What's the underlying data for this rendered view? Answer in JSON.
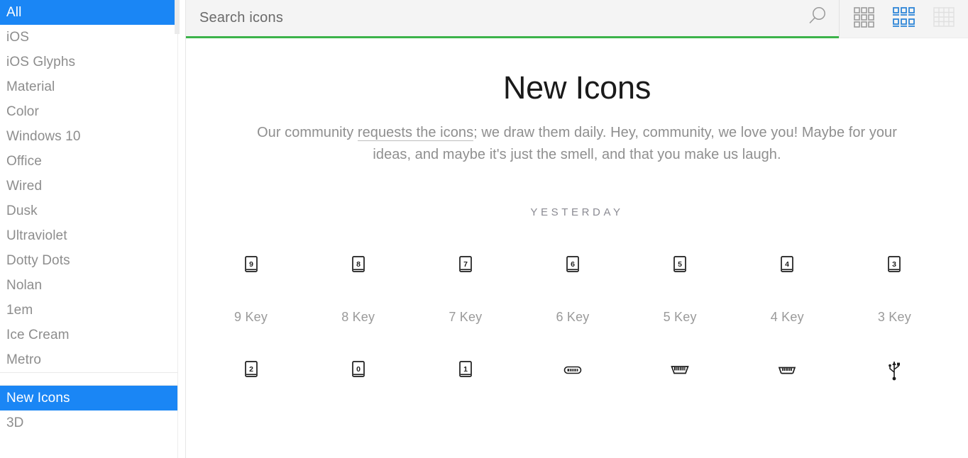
{
  "sidebar": {
    "groups": [
      {
        "items": [
          {
            "label": "All",
            "selected": true
          },
          {
            "label": "iOS",
            "selected": false
          },
          {
            "label": "iOS Glyphs",
            "selected": false
          },
          {
            "label": "Material",
            "selected": false
          },
          {
            "label": "Color",
            "selected": false
          },
          {
            "label": "Windows 10",
            "selected": false
          },
          {
            "label": "Office",
            "selected": false
          },
          {
            "label": "Wired",
            "selected": false
          },
          {
            "label": "Dusk",
            "selected": false
          },
          {
            "label": "Ultraviolet",
            "selected": false
          },
          {
            "label": "Dotty Dots",
            "selected": false
          },
          {
            "label": "Nolan",
            "selected": false
          },
          {
            "label": "1em",
            "selected": false
          },
          {
            "label": "Ice Cream",
            "selected": false
          },
          {
            "label": "Metro",
            "selected": false
          }
        ]
      },
      {
        "items": [
          {
            "label": "New Icons",
            "selected": true
          },
          {
            "label": "3D",
            "selected": false
          }
        ]
      }
    ]
  },
  "header": {
    "search": {
      "placeholder": "Search icons",
      "value": "",
      "icon": "search-icon"
    },
    "view_modes": [
      {
        "name": "grid-view",
        "icon": "grid-3x3-icon",
        "active": false
      },
      {
        "name": "list-view",
        "icon": "grid-labeled-icon",
        "active": true
      },
      {
        "name": "compact-view",
        "icon": "table-grid-icon",
        "active": false
      }
    ],
    "accent_color": "#3cb34a"
  },
  "main": {
    "title": "New Icons",
    "description_before": "Our community ",
    "description_link": "requests the icons",
    "description_after": "; we draw them daily. Hey, community, we love you! Maybe for your ideas, and maybe it's just the smell, and that you make us laugh.",
    "group_label": "YESTERDAY",
    "icons": [
      {
        "label": "9 Key",
        "glyph": "key-9-icon",
        "type": "key",
        "char": "9"
      },
      {
        "label": "8 Key",
        "glyph": "key-8-icon",
        "type": "key",
        "char": "8"
      },
      {
        "label": "7 Key",
        "glyph": "key-7-icon",
        "type": "key",
        "char": "7"
      },
      {
        "label": "6 Key",
        "glyph": "key-6-icon",
        "type": "key",
        "char": "6"
      },
      {
        "label": "5 Key",
        "glyph": "key-5-icon",
        "type": "key",
        "char": "5"
      },
      {
        "label": "4 Key",
        "glyph": "key-4-icon",
        "type": "key",
        "char": "4"
      },
      {
        "label": "3 Key",
        "glyph": "key-3-icon",
        "type": "key",
        "char": "3"
      },
      {
        "label": "",
        "glyph": "key-2-icon",
        "type": "key",
        "char": "2"
      },
      {
        "label": "",
        "glyph": "key-0-icon",
        "type": "key",
        "char": "0"
      },
      {
        "label": "",
        "glyph": "key-1-icon",
        "type": "key",
        "char": "1"
      },
      {
        "label": "",
        "glyph": "usb-c-icon",
        "type": "usbc"
      },
      {
        "label": "",
        "glyph": "micro-usb-icon",
        "type": "microusb"
      },
      {
        "label": "",
        "glyph": "mini-usb-icon",
        "type": "miniusb"
      },
      {
        "label": "",
        "glyph": "usb-symbol-icon",
        "type": "usbsym"
      }
    ]
  },
  "colors": {
    "selection_blue": "#1a86f5",
    "accent_green": "#3cb34a",
    "header_bg": "#f4f4f4",
    "muted_text": "#8f8f8f"
  }
}
